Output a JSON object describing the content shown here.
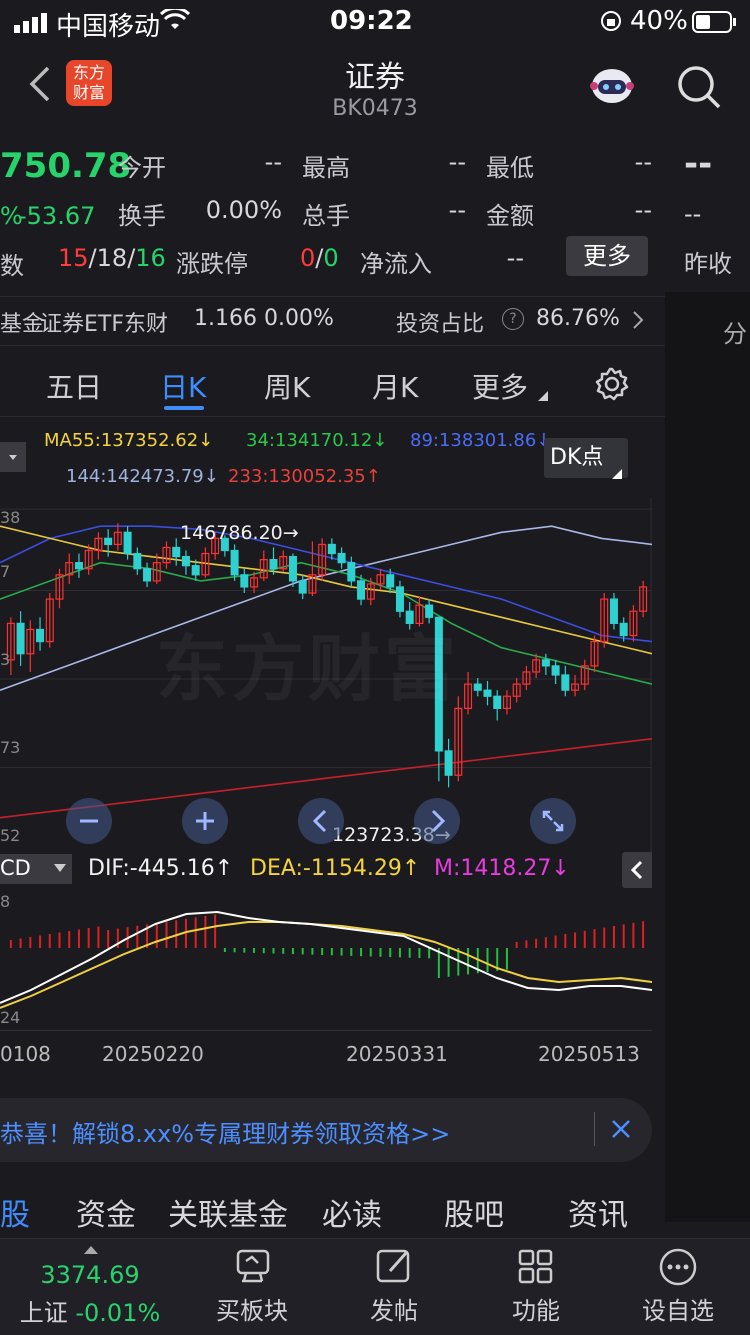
{
  "status": {
    "carrier": "中国移动",
    "time": "09:22",
    "battery": "40%"
  },
  "header": {
    "title": "证券",
    "code": "BK0473",
    "logo_line1": "东方",
    "logo_line2": "财富"
  },
  "quote": {
    "price": "750.78",
    "change": "-53.67",
    "change_prefix": "%",
    "labels": {
      "open": "今开",
      "high": "最高",
      "low": "最低",
      "turnover": "换手",
      "volume": "总手",
      "amount": "金额",
      "limit": "涨跌停",
      "netflow": "净流入",
      "prev_close": "昨收",
      "count_prefix": "数"
    },
    "values": {
      "open": "--",
      "high": "--",
      "low": "--",
      "turnover": "0.00%",
      "volume": "--",
      "amount": "--",
      "netflow": "--",
      "right_big": "--",
      "right_small": "--"
    },
    "updown": {
      "up": "15",
      "flat": "18",
      "down": "16"
    },
    "limit": {
      "up": "0",
      "down": "0"
    },
    "more_button": "更多"
  },
  "etf": {
    "prefix": "基金",
    "name": "证券ETF东财",
    "price": "1.166",
    "pct": "0.00%",
    "ratio_label": "投资占比",
    "ratio": "86.76%",
    "side_label": "分"
  },
  "tabs": [
    "五日",
    "日K",
    "周K",
    "月K",
    "更多"
  ],
  "ma": {
    "ma55": "MA55:137352.62↓",
    "ma34": "34:134170.12↓",
    "ma89": "89:138301.86↓",
    "ma144": "144:142473.79↓",
    "ma233": "233:130052.35↑",
    "dk": "DK点"
  },
  "chart_data": {
    "type": "candlestick",
    "high_mark": "146786.20",
    "low_mark": "123723.38",
    "y_ticks": [
      "38",
      "7",
      "3",
      "73",
      "52"
    ],
    "x_ticks": [
      "0108",
      "20250220",
      "20250331",
      "20250513"
    ],
    "watermark": "东方财富",
    "candles": [
      [
        60,
        72,
        55,
        74
      ],
      [
        72,
        62,
        58,
        76
      ],
      [
        62,
        70,
        56,
        73
      ],
      [
        70,
        66,
        63,
        74
      ],
      [
        66,
        80,
        64,
        82
      ],
      [
        80,
        88,
        77,
        90
      ],
      [
        88,
        92,
        85,
        95
      ],
      [
        92,
        90,
        87,
        95
      ],
      [
        90,
        96,
        88,
        98
      ],
      [
        96,
        100,
        93,
        102
      ],
      [
        100,
        98,
        94,
        103
      ],
      [
        98,
        102,
        96,
        105
      ],
      [
        102,
        95,
        93,
        104
      ],
      [
        95,
        90,
        88,
        97
      ],
      [
        90,
        86,
        84,
        92
      ],
      [
        86,
        92,
        85,
        95
      ],
      [
        92,
        97,
        90,
        99
      ],
      [
        97,
        94,
        91,
        100
      ],
      [
        94,
        91,
        88,
        96
      ],
      [
        91,
        88,
        86,
        93
      ],
      [
        88,
        95,
        87,
        97
      ],
      [
        95,
        100,
        93,
        102
      ],
      [
        100,
        96,
        94,
        101
      ],
      [
        96,
        88,
        86,
        98
      ],
      [
        88,
        84,
        82,
        90
      ],
      [
        84,
        87,
        82,
        89
      ],
      [
        87,
        93,
        86,
        96
      ],
      [
        93,
        90,
        88,
        97
      ],
      [
        90,
        94,
        89,
        96
      ],
      [
        94,
        86,
        84,
        95
      ],
      [
        86,
        82,
        80,
        88
      ],
      [
        82,
        88,
        81,
        99
      ],
      [
        88,
        98,
        86,
        100
      ],
      [
        98,
        95,
        93,
        100
      ],
      [
        95,
        92,
        90,
        97
      ],
      [
        92,
        86,
        84,
        94
      ],
      [
        86,
        80,
        78,
        88
      ],
      [
        80,
        85,
        78,
        87
      ],
      [
        85,
        88,
        83,
        90
      ],
      [
        88,
        84,
        82,
        90
      ],
      [
        84,
        76,
        74,
        86
      ],
      [
        76,
        72,
        70,
        79
      ],
      [
        72,
        78,
        71,
        81
      ],
      [
        78,
        74,
        72,
        80
      ],
      [
        74,
        30,
        20,
        48
      ],
      [
        30,
        22,
        18,
        34
      ],
      [
        22,
        44,
        20,
        48
      ],
      [
        44,
        52,
        42,
        56
      ],
      [
        52,
        50,
        48,
        54
      ],
      [
        50,
        48,
        45,
        53
      ],
      [
        48,
        44,
        40,
        50
      ],
      [
        44,
        48,
        42,
        50
      ],
      [
        48,
        52,
        46,
        54
      ],
      [
        52,
        56,
        50,
        58
      ],
      [
        56,
        60,
        54,
        62
      ],
      [
        60,
        58,
        55,
        62
      ],
      [
        58,
        55,
        52,
        60
      ],
      [
        55,
        50,
        48,
        58
      ],
      [
        50,
        52,
        48,
        55
      ],
      [
        52,
        58,
        50,
        60
      ],
      [
        58,
        66,
        56,
        68
      ],
      [
        66,
        80,
        64,
        82
      ],
      [
        80,
        72,
        70,
        82
      ],
      [
        72,
        68,
        66,
        74
      ],
      [
        68,
        76,
        66,
        78
      ],
      [
        76,
        84,
        74,
        86
      ]
    ],
    "macd_labels": {
      "name": "CD",
      "dif": "DIF:-445.16↑",
      "dea": "DEA:-1154.29↑",
      "m": "M:1418.27↓",
      "top": "8",
      "bottom": "24"
    }
  },
  "banner": {
    "text": "恭喜！解锁8.xx%专属理财券领取资格>>"
  },
  "bottom_tabs": [
    "股",
    "资金",
    "关联基金",
    "必读",
    "股吧",
    "资讯"
  ],
  "footer": {
    "index_value": "3374.69",
    "index_name": "上证",
    "index_change": "-0.01%",
    "items": [
      "买板块",
      "发帖",
      "功能",
      "设自选"
    ]
  }
}
